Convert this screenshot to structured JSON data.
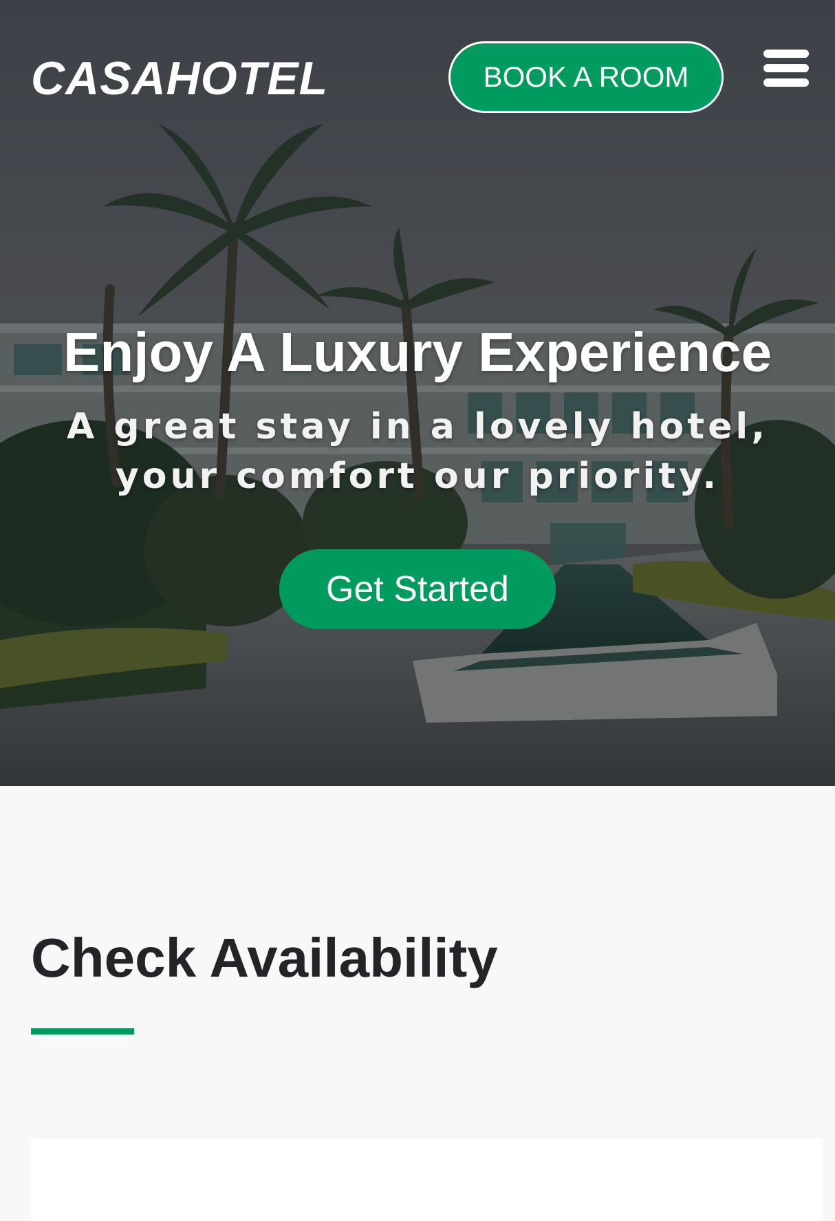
{
  "brand": {
    "logo_text": "CASAHOTEL"
  },
  "header": {
    "book_label": "BOOK A ROOM",
    "menu_icon": "hamburger-menu-icon"
  },
  "hero": {
    "title": "Enjoy A Luxury Experience",
    "subtitle": "A great stay in a lovely hotel, your comfort our priority.",
    "cta_label": "Get Started",
    "background": "hotel courtyard with palm trees and reflecting pool"
  },
  "availability": {
    "title": "Check Availability"
  },
  "colors": {
    "accent": "#019a5f",
    "heading": "#222428",
    "section_bg": "#f8f8f8"
  }
}
